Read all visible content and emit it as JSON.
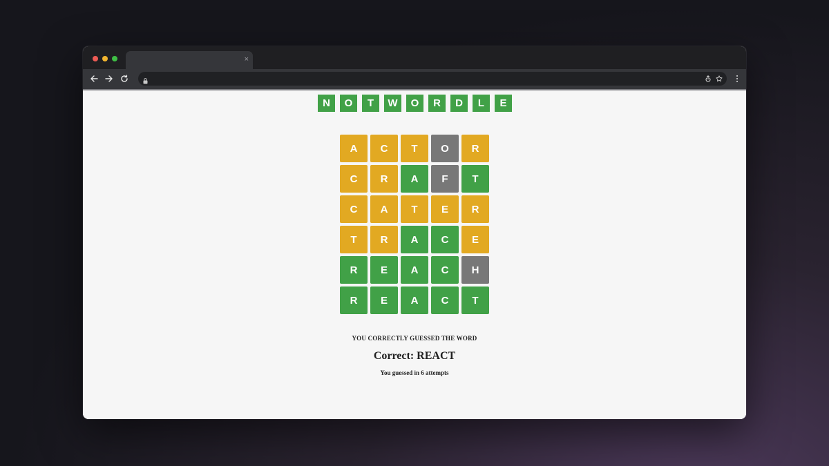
{
  "browser": {
    "traffic_lights": [
      "#ee5b55",
      "#f2b52f",
      "#3fbf45"
    ],
    "tab": {
      "title": "",
      "close_glyph": "×"
    },
    "address": {
      "url": ""
    }
  },
  "game": {
    "logo_letters": [
      "N",
      "O",
      "T",
      "W",
      "O",
      "R",
      "D",
      "L",
      "E"
    ],
    "colors": {
      "correct": "#41a147",
      "present": "#e2a922",
      "absent": "#787878"
    },
    "board": [
      [
        {
          "l": "A",
          "s": "present"
        },
        {
          "l": "C",
          "s": "present"
        },
        {
          "l": "T",
          "s": "present"
        },
        {
          "l": "O",
          "s": "absent"
        },
        {
          "l": "R",
          "s": "present"
        }
      ],
      [
        {
          "l": "C",
          "s": "present"
        },
        {
          "l": "R",
          "s": "present"
        },
        {
          "l": "A",
          "s": "correct"
        },
        {
          "l": "F",
          "s": "absent"
        },
        {
          "l": "T",
          "s": "correct"
        }
      ],
      [
        {
          "l": "C",
          "s": "present"
        },
        {
          "l": "A",
          "s": "present"
        },
        {
          "l": "T",
          "s": "present"
        },
        {
          "l": "E",
          "s": "present"
        },
        {
          "l": "R",
          "s": "present"
        }
      ],
      [
        {
          "l": "T",
          "s": "present"
        },
        {
          "l": "R",
          "s": "present"
        },
        {
          "l": "A",
          "s": "correct"
        },
        {
          "l": "C",
          "s": "correct"
        },
        {
          "l": "E",
          "s": "present"
        }
      ],
      [
        {
          "l": "R",
          "s": "correct"
        },
        {
          "l": "E",
          "s": "correct"
        },
        {
          "l": "A",
          "s": "correct"
        },
        {
          "l": "C",
          "s": "correct"
        },
        {
          "l": "H",
          "s": "absent"
        }
      ],
      [
        {
          "l": "R",
          "s": "correct"
        },
        {
          "l": "E",
          "s": "correct"
        },
        {
          "l": "A",
          "s": "correct"
        },
        {
          "l": "C",
          "s": "correct"
        },
        {
          "l": "T",
          "s": "correct"
        }
      ]
    ],
    "result": {
      "message": "YOU CORRECTLY GUESSED THE WORD",
      "correct_line": "Correct: REACT",
      "attempts_line": "You guessed in 6 attempts"
    }
  }
}
